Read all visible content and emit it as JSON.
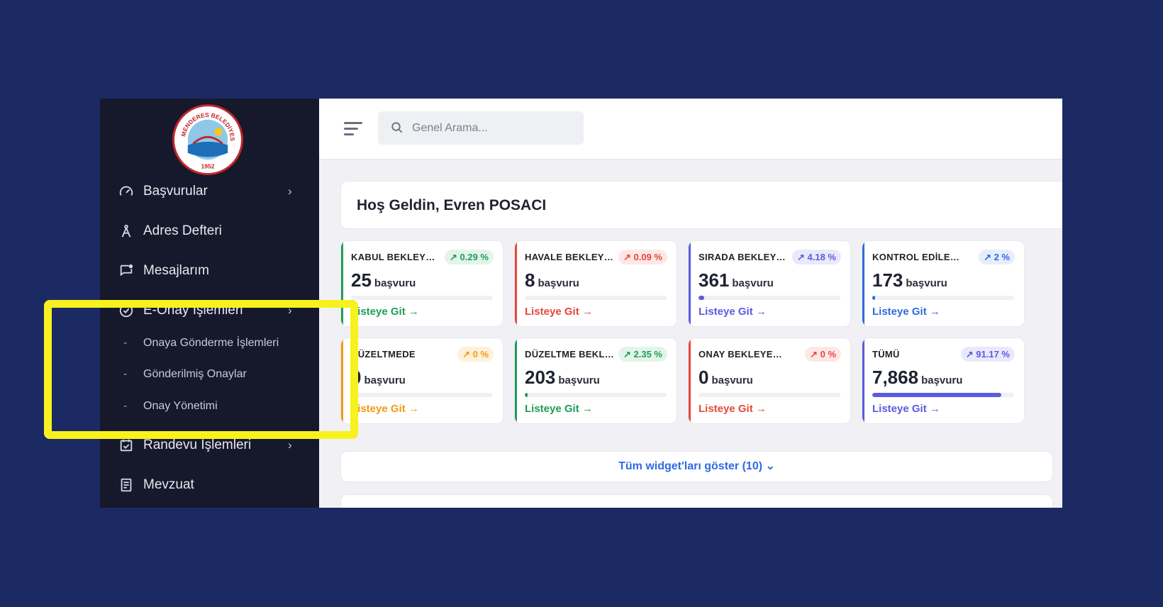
{
  "sidebar": {
    "logo": {
      "org": "MENDERES BELEDİYESİ",
      "year": "1952",
      "icon": "municipality-seal"
    },
    "items": [
      {
        "label": "Başvurular",
        "icon": "speedometer-icon",
        "chevron": "›"
      },
      {
        "label": "Adres Defteri",
        "icon": "compass-icon"
      },
      {
        "label": "Mesajlarım",
        "icon": "message-icon"
      },
      {
        "label": "E-Onay İşlemleri",
        "icon": "check-circle-icon",
        "chevron": "›"
      },
      {
        "label": "Randevu İşlemleri",
        "icon": "calendar-check-icon",
        "chevron": "›"
      },
      {
        "label": "Mevzuat",
        "icon": "document-list-icon"
      }
    ],
    "subitems": [
      {
        "label": "Onaya Gönderme İşlemleri",
        "dash": "-"
      },
      {
        "label": "Gönderilmiş Onaylar",
        "dash": "-"
      },
      {
        "label": "Onay Yönetimi",
        "dash": "-"
      }
    ]
  },
  "search": {
    "placeholder": "Genel Arama..."
  },
  "welcome": "Hoş Geldin, Evren POSACI",
  "cards": [
    {
      "title": "KABUL BEKLEYENLER",
      "badge": "↗ 0.29 %",
      "value": "25",
      "unit": "başvuru",
      "link": "Listeye Git →",
      "progress": 0,
      "color": "#1f9d55"
    },
    {
      "title": "HAVALE BEKLEYENLER",
      "badge": "↗ 0.09 %",
      "value": "8",
      "unit": "başvuru",
      "link": "Listeye Git →",
      "progress": 0,
      "color": "#e5483b"
    },
    {
      "title": "SIRADA BEKLEYENLER",
      "badge": "↗ 4.18 %",
      "value": "361",
      "unit": "başvuru",
      "link": "Listeye Git →",
      "progress": 0.04,
      "color": "#5b5be0"
    },
    {
      "title": "KONTROL EDİLENLER",
      "badge": "↗ 2 %",
      "value": "173",
      "unit": "başvuru",
      "link": "Listeye Git →",
      "progress": 0.02,
      "color": "#2f6ae3"
    },
    {
      "title": "DÜZELTMEDE",
      "badge": "↗ 0 %",
      "value": "0",
      "unit": "başvuru",
      "link": "Listeye Git →",
      "progress": 0,
      "color": "#f29b13"
    },
    {
      "title": "DÜZELTME BEKLEYENLER",
      "badge": "↗ 2.35 %",
      "value": "203",
      "unit": "başvuru",
      "link": "Listeye Git →",
      "progress": 0.02,
      "color": "#1f9d55"
    },
    {
      "title": "ONAY BEKLEYENLER",
      "badge": "↗ 0 %",
      "value": "0",
      "unit": "başvuru",
      "link": "Listeye Git →",
      "progress": 0,
      "color": "#e5483b"
    },
    {
      "title": "TÜMÜ",
      "badge": "↗ 91.17 %",
      "value": "7,868",
      "unit": "başvuru",
      "link": "Listeye Git →",
      "progress": 0.91,
      "color": "#5b5be0"
    }
  ],
  "show_all": "Tüm widget'ları göster (10) ⌄"
}
